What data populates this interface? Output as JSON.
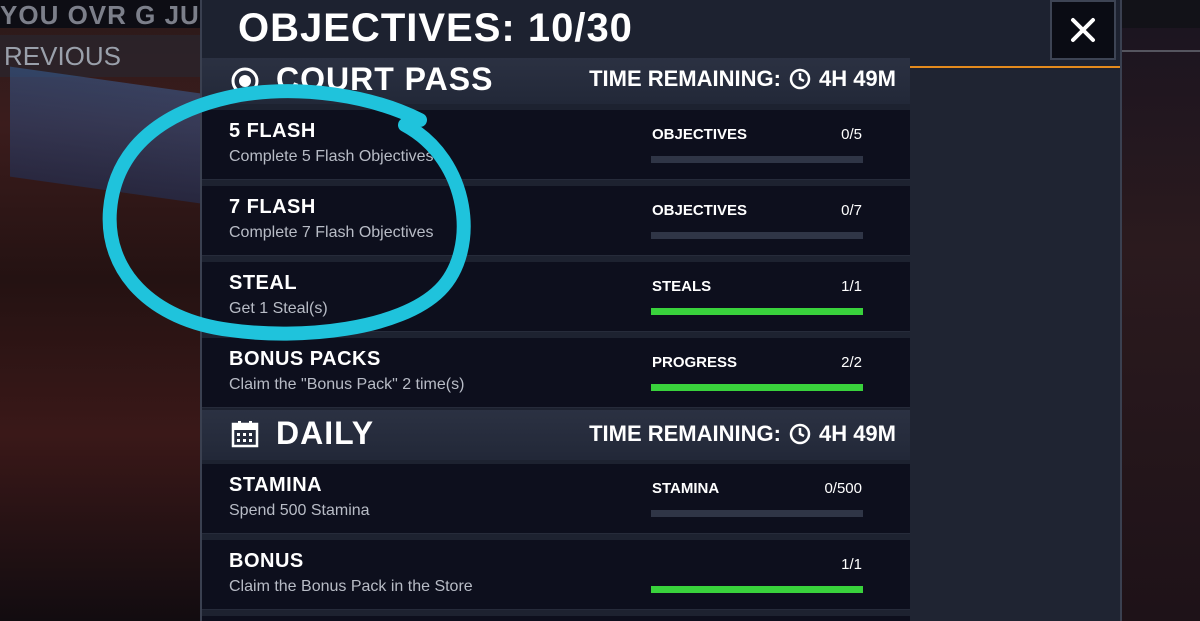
{
  "background": {
    "headline": "YOU OVR G JULE",
    "previous_label": "REVIOUS"
  },
  "modal": {
    "title": "OBJECTIVES: 10/30",
    "close_icon": "close-icon",
    "accent_color": "#e38a1d"
  },
  "sections": [
    {
      "title": "COURT PASS",
      "icon": "court-pass-icon",
      "time_remaining": "TIME REMAINING:",
      "time_value": "4H 49M",
      "rows": [
        {
          "title": "5 FLASH",
          "desc": "Complete 5 Flash Objectives",
          "label": "OBJECTIVES",
          "count": "0/5",
          "progress": 0
        },
        {
          "title": "7 FLASH",
          "desc": "Complete 7 Flash Objectives",
          "label": "OBJECTIVES",
          "count": "0/7",
          "progress": 0
        },
        {
          "title": "STEAL",
          "desc": "Get 1 Steal(s)",
          "label": "STEALS",
          "count": "1/1",
          "progress": 1
        },
        {
          "title": "BONUS PACKS",
          "desc": "Claim the \"Bonus Pack\" 2 time(s)",
          "label": "PROGRESS",
          "count": "2/2",
          "progress": 1
        }
      ]
    },
    {
      "title": "DAILY",
      "icon": "calendar-icon",
      "time_remaining": "TIME REMAINING:",
      "time_value": "4H 49M",
      "rows": [
        {
          "title": "STAMINA",
          "desc": "Spend 500 Stamina",
          "label": "STAMINA",
          "count": "0/500",
          "progress": 0
        },
        {
          "title": "BONUS",
          "desc": "Claim the Bonus Pack in the Store",
          "label": "",
          "count": "1/1",
          "progress": 1
        }
      ]
    }
  ],
  "colors": {
    "progress_fill": "#39d23c",
    "annotation": "#1fc3dc"
  }
}
